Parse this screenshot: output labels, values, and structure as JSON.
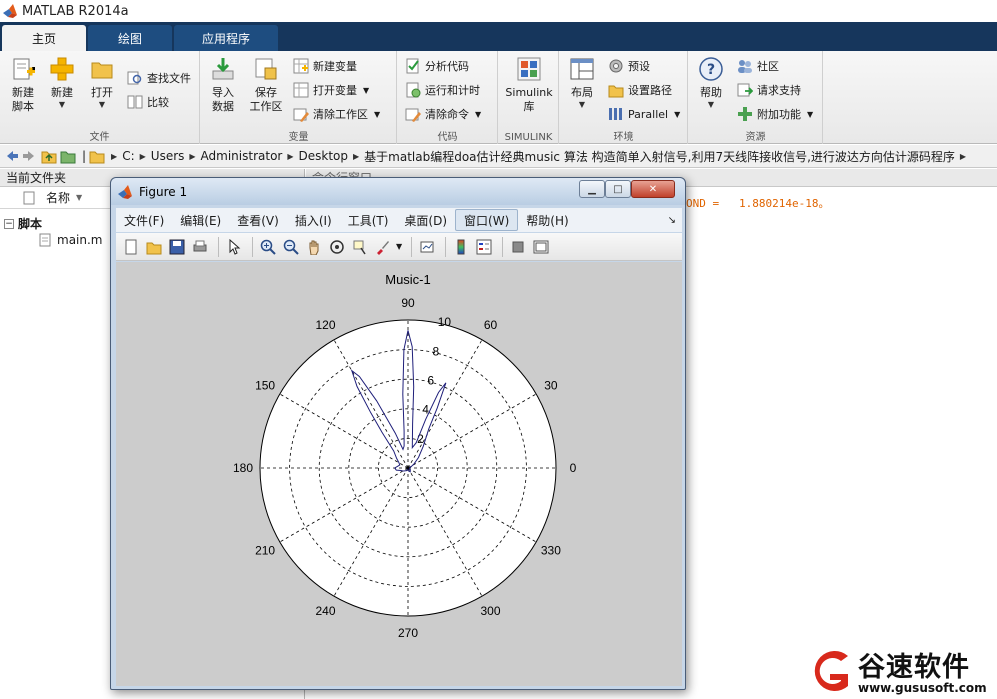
{
  "app": {
    "title": "MATLAB R2014a"
  },
  "tabs": [
    {
      "label": "主页",
      "active": true
    },
    {
      "label": "绘图",
      "active": false
    },
    {
      "label": "应用程序",
      "active": false
    }
  ],
  "ribbon": {
    "file": {
      "label": "文件",
      "new_script": [
        "新建",
        "脚本"
      ],
      "new": "新建",
      "open": "打开",
      "find_files": "查找文件",
      "compare": "比较"
    },
    "variable": {
      "label": "变量",
      "import": [
        "导入",
        "数据"
      ],
      "save": [
        "保存",
        "工作区"
      ],
      "new_variable": "新建变量",
      "open_variable": "打开变量",
      "clear_workspace": "清除工作区"
    },
    "code": {
      "label": "代码",
      "analyze": "分析代码",
      "run_time": "运行和计时",
      "clear_commands": "清除命令"
    },
    "simulink": {
      "label": "SIMULINK",
      "button": [
        "Simulink",
        "库"
      ]
    },
    "environment": {
      "label": "环境",
      "layout": "布局",
      "preferences": "预设",
      "set_path": "设置路径",
      "parallel": "Parallel"
    },
    "resources": {
      "label": "资源",
      "help": "帮助",
      "community": "社区",
      "support": "请求支持",
      "addons": "附加功能"
    }
  },
  "address": {
    "crumbs": [
      "C:",
      "Users",
      "Administrator",
      "Desktop",
      "基于matlab编程doa估计经典music 算法 构造简单入射信号,利用7天线阵接收信号,进行波达方向估计源码程序"
    ]
  },
  "current_folder": {
    "title": "当前文件夹",
    "column": "名称",
    "group": "脚本",
    "file": "main.m"
  },
  "command_window": {
    "title": "命令行窗口",
    "output": "OND =   1.880214e-18。"
  },
  "figure": {
    "title": "Figure 1",
    "menus": [
      "文件(F)",
      "编辑(E)",
      "查看(V)",
      "插入(I)",
      "工具(T)",
      "桌面(D)",
      "窗口(W)",
      "帮助(H)"
    ],
    "active_menu_index": 6
  },
  "chart_data": {
    "type": "polar",
    "title": "Music-1",
    "angle_ticks": [
      "0",
      "30",
      "60",
      "90",
      "120",
      "150",
      "180",
      "210",
      "240",
      "270",
      "300",
      "330"
    ],
    "radial_ticks": [
      "2",
      "4",
      "6",
      "8",
      "10"
    ],
    "rmax": 10,
    "grid": true,
    "series": [
      {
        "color": "#1f1f7a",
        "theta_deg": [
          0,
          20,
          35,
          45,
          55,
          62,
          64,
          66,
          68,
          70,
          72,
          78,
          84,
          86,
          88,
          90,
          92,
          94,
          96,
          100,
          105,
          110,
          115,
          118,
          120,
          122,
          124,
          126,
          130,
          140,
          150,
          160,
          170,
          180,
          190,
          200,
          210,
          220,
          240,
          260,
          280,
          300,
          320,
          340,
          360
        ],
        "r": [
          0.1,
          0.2,
          0.5,
          1,
          1.8,
          3,
          4.5,
          6.3,
          5.5,
          3.5,
          1.8,
          1.4,
          3,
          5.5,
          8.2,
          9.3,
          8,
          5,
          2.5,
          1.5,
          1.3,
          2.5,
          5,
          7,
          7.6,
          6.5,
          4.5,
          3,
          1.5,
          1,
          0.7,
          0.6,
          0.7,
          0.9,
          0.8,
          0.5,
          0.4,
          0.3,
          0.2,
          0.1,
          0.2,
          0.3,
          0.2,
          0.1,
          0.1
        ]
      }
    ]
  },
  "watermark": {
    "brand": "谷速软件",
    "url": "www.gususoft.com"
  }
}
